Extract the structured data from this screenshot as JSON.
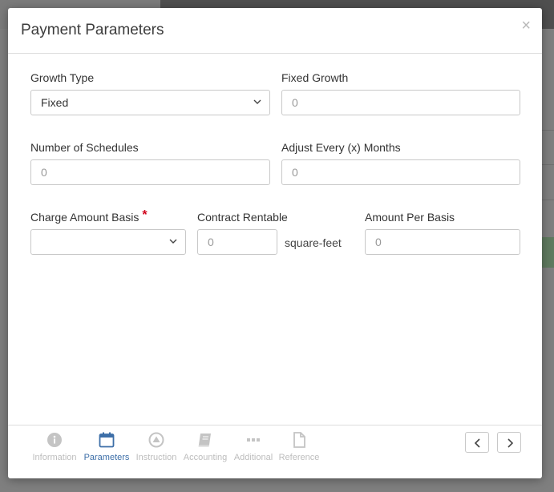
{
  "modal": {
    "title": "Payment Parameters",
    "close_label": "×"
  },
  "form": {
    "growth_type": {
      "label": "Growth Type",
      "value": "Fixed"
    },
    "fixed_growth": {
      "label": "Fixed Growth",
      "placeholder": "0"
    },
    "number_of_schedules": {
      "label": "Number of Schedules",
      "placeholder": "0"
    },
    "adjust_every_months": {
      "label": "Adjust Every (x) Months",
      "placeholder": "0"
    },
    "charge_amount_basis": {
      "label": "Charge Amount Basis",
      "required_mark": "*",
      "value": ""
    },
    "contract_rentable": {
      "label": "Contract Rentable",
      "placeholder": "0",
      "unit": "square-feet"
    },
    "amount_per_basis": {
      "label": "Amount Per Basis",
      "placeholder": "0"
    }
  },
  "tabs": [
    {
      "label": "Information",
      "icon": "info-circle-icon",
      "active": false
    },
    {
      "label": "Parameters",
      "icon": "calendar-icon",
      "active": true
    },
    {
      "label": "Instruction",
      "icon": "triangle-circle-icon",
      "active": false
    },
    {
      "label": "Accounting",
      "icon": "book-icon",
      "active": false
    },
    {
      "label": "Additional",
      "icon": "ellipsis-icon",
      "active": false
    },
    {
      "label": "Reference",
      "icon": "file-icon",
      "active": false
    }
  ],
  "colors": {
    "active_tab": "#3d6fa8",
    "inactive_tab": "#bdbdbd",
    "required": "#d0021b"
  }
}
